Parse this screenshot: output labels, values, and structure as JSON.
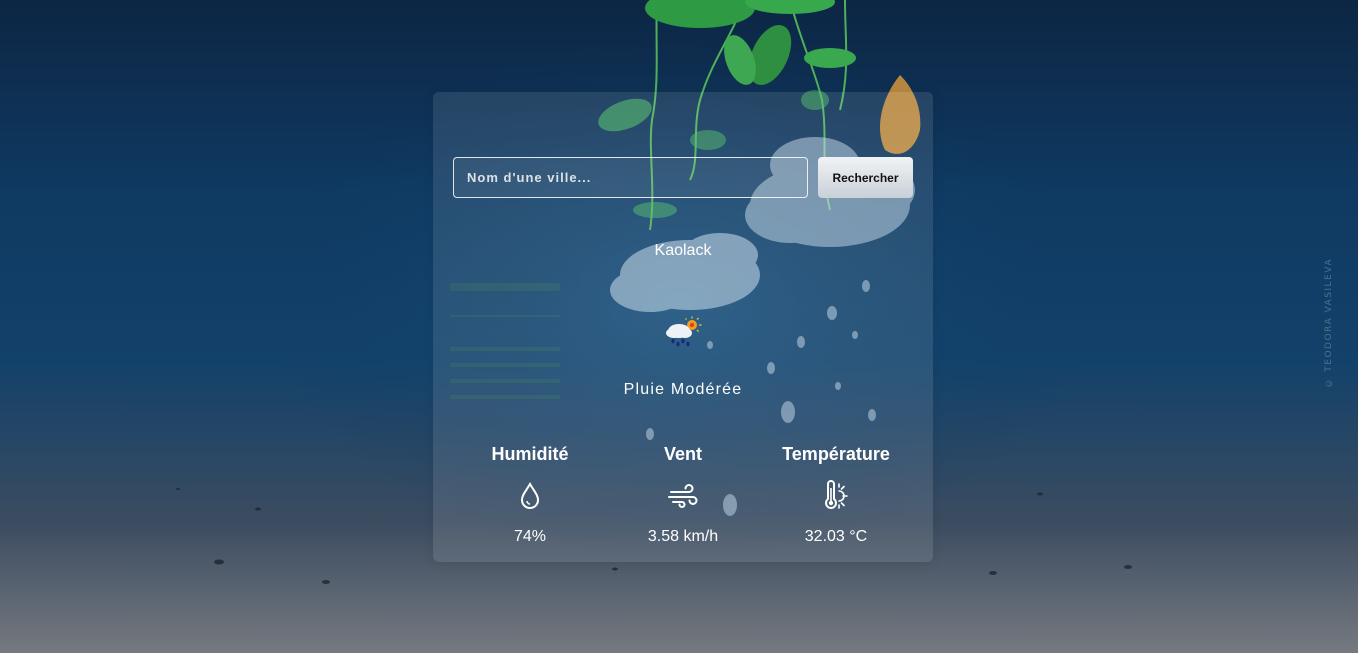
{
  "search": {
    "placeholder": "Nom d'une ville...",
    "button_label": "Rechercher"
  },
  "weather": {
    "city": "Kaolack",
    "description": "Pluie Modérée",
    "icon": "rain-sun-cloud-icon"
  },
  "stats": {
    "humidity": {
      "label": "Humidité",
      "value": "74%",
      "icon": "water-drop-icon"
    },
    "wind": {
      "label": "Vent",
      "value": "3.58 km/h",
      "icon": "wind-icon"
    },
    "temperature": {
      "label": "Température",
      "value": "32.03 °C",
      "icon": "thermometer-sun-icon"
    }
  },
  "background": {
    "credit": "© TEODORA VASILEVA"
  }
}
